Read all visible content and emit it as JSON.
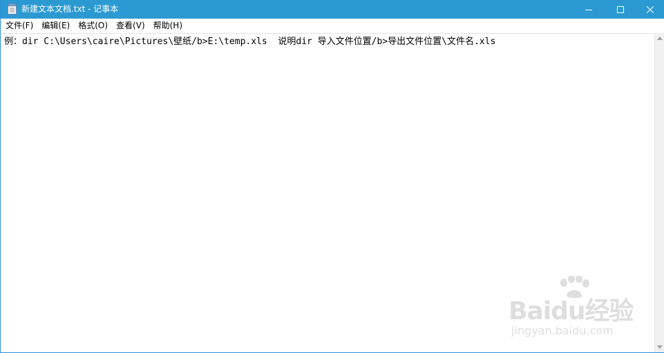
{
  "window": {
    "title": "新建文本文档.txt - 记事本",
    "title_bar_color": "#2b9ad3"
  },
  "menu": {
    "items": [
      {
        "label": "文件(F)"
      },
      {
        "label": "编辑(E)"
      },
      {
        "label": "格式(O)"
      },
      {
        "label": "查看(V)"
      },
      {
        "label": "帮助(H)"
      }
    ]
  },
  "editor": {
    "content": "例：dir C:\\Users\\caire\\Pictures\\壁纸/b>E:\\temp.xls  说明dir 导入文件位置/b>导出文件位置\\文件名.xls"
  },
  "watermark": {
    "brand": "Baidu经验",
    "url": "jingyan.baidu.com"
  },
  "icons": {
    "app": "notepad-icon",
    "minimize": "minimize-icon",
    "maximize": "maximize-icon",
    "close": "close-icon"
  }
}
